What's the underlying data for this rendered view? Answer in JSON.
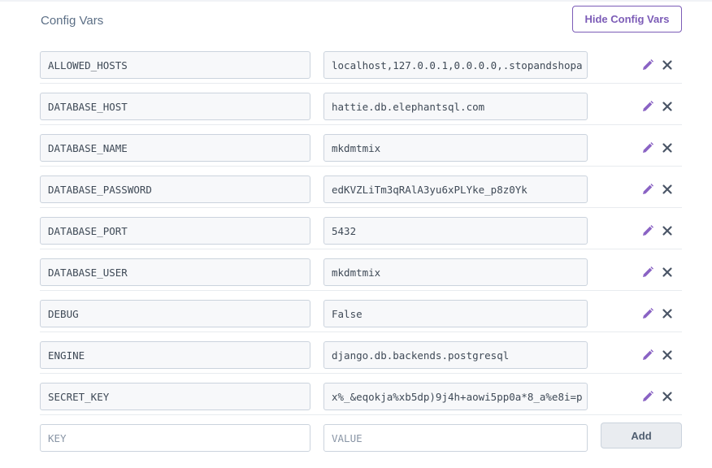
{
  "header": {
    "title": "Config Vars",
    "hide_button": "Hide Config Vars"
  },
  "colors": {
    "accent": "#7c5cb7",
    "edit_icon": "#8a63c4",
    "delete_icon": "#4a5566"
  },
  "icons": {
    "edit": "pencil-icon",
    "delete": "close-icon"
  },
  "config_vars": [
    {
      "key": "ALLOWED_HOSTS",
      "value": "localhost,127.0.0.1,0.0.0.0,.stopandshopa"
    },
    {
      "key": "DATABASE_HOST",
      "value": "hattie.db.elephantsql.com"
    },
    {
      "key": "DATABASE_NAME",
      "value": "mkdmtmix"
    },
    {
      "key": "DATABASE_PASSWORD",
      "value": "edKVZLiTm3qRAlA3yu6xPLYke_p8z0Yk"
    },
    {
      "key": "DATABASE_PORT",
      "value": "5432"
    },
    {
      "key": "DATABASE_USER",
      "value": "mkdmtmix"
    },
    {
      "key": "DEBUG",
      "value": "False"
    },
    {
      "key": "ENGINE",
      "value": "django.db.backends.postgresql"
    },
    {
      "key": "SECRET_KEY",
      "value": "x%_&eqokja%xb5dp)9j4h+aowi5pp0a*8_a%e8i=p"
    }
  ],
  "new_var": {
    "key_placeholder": "KEY",
    "value_placeholder": "VALUE",
    "add_button": "Add"
  }
}
